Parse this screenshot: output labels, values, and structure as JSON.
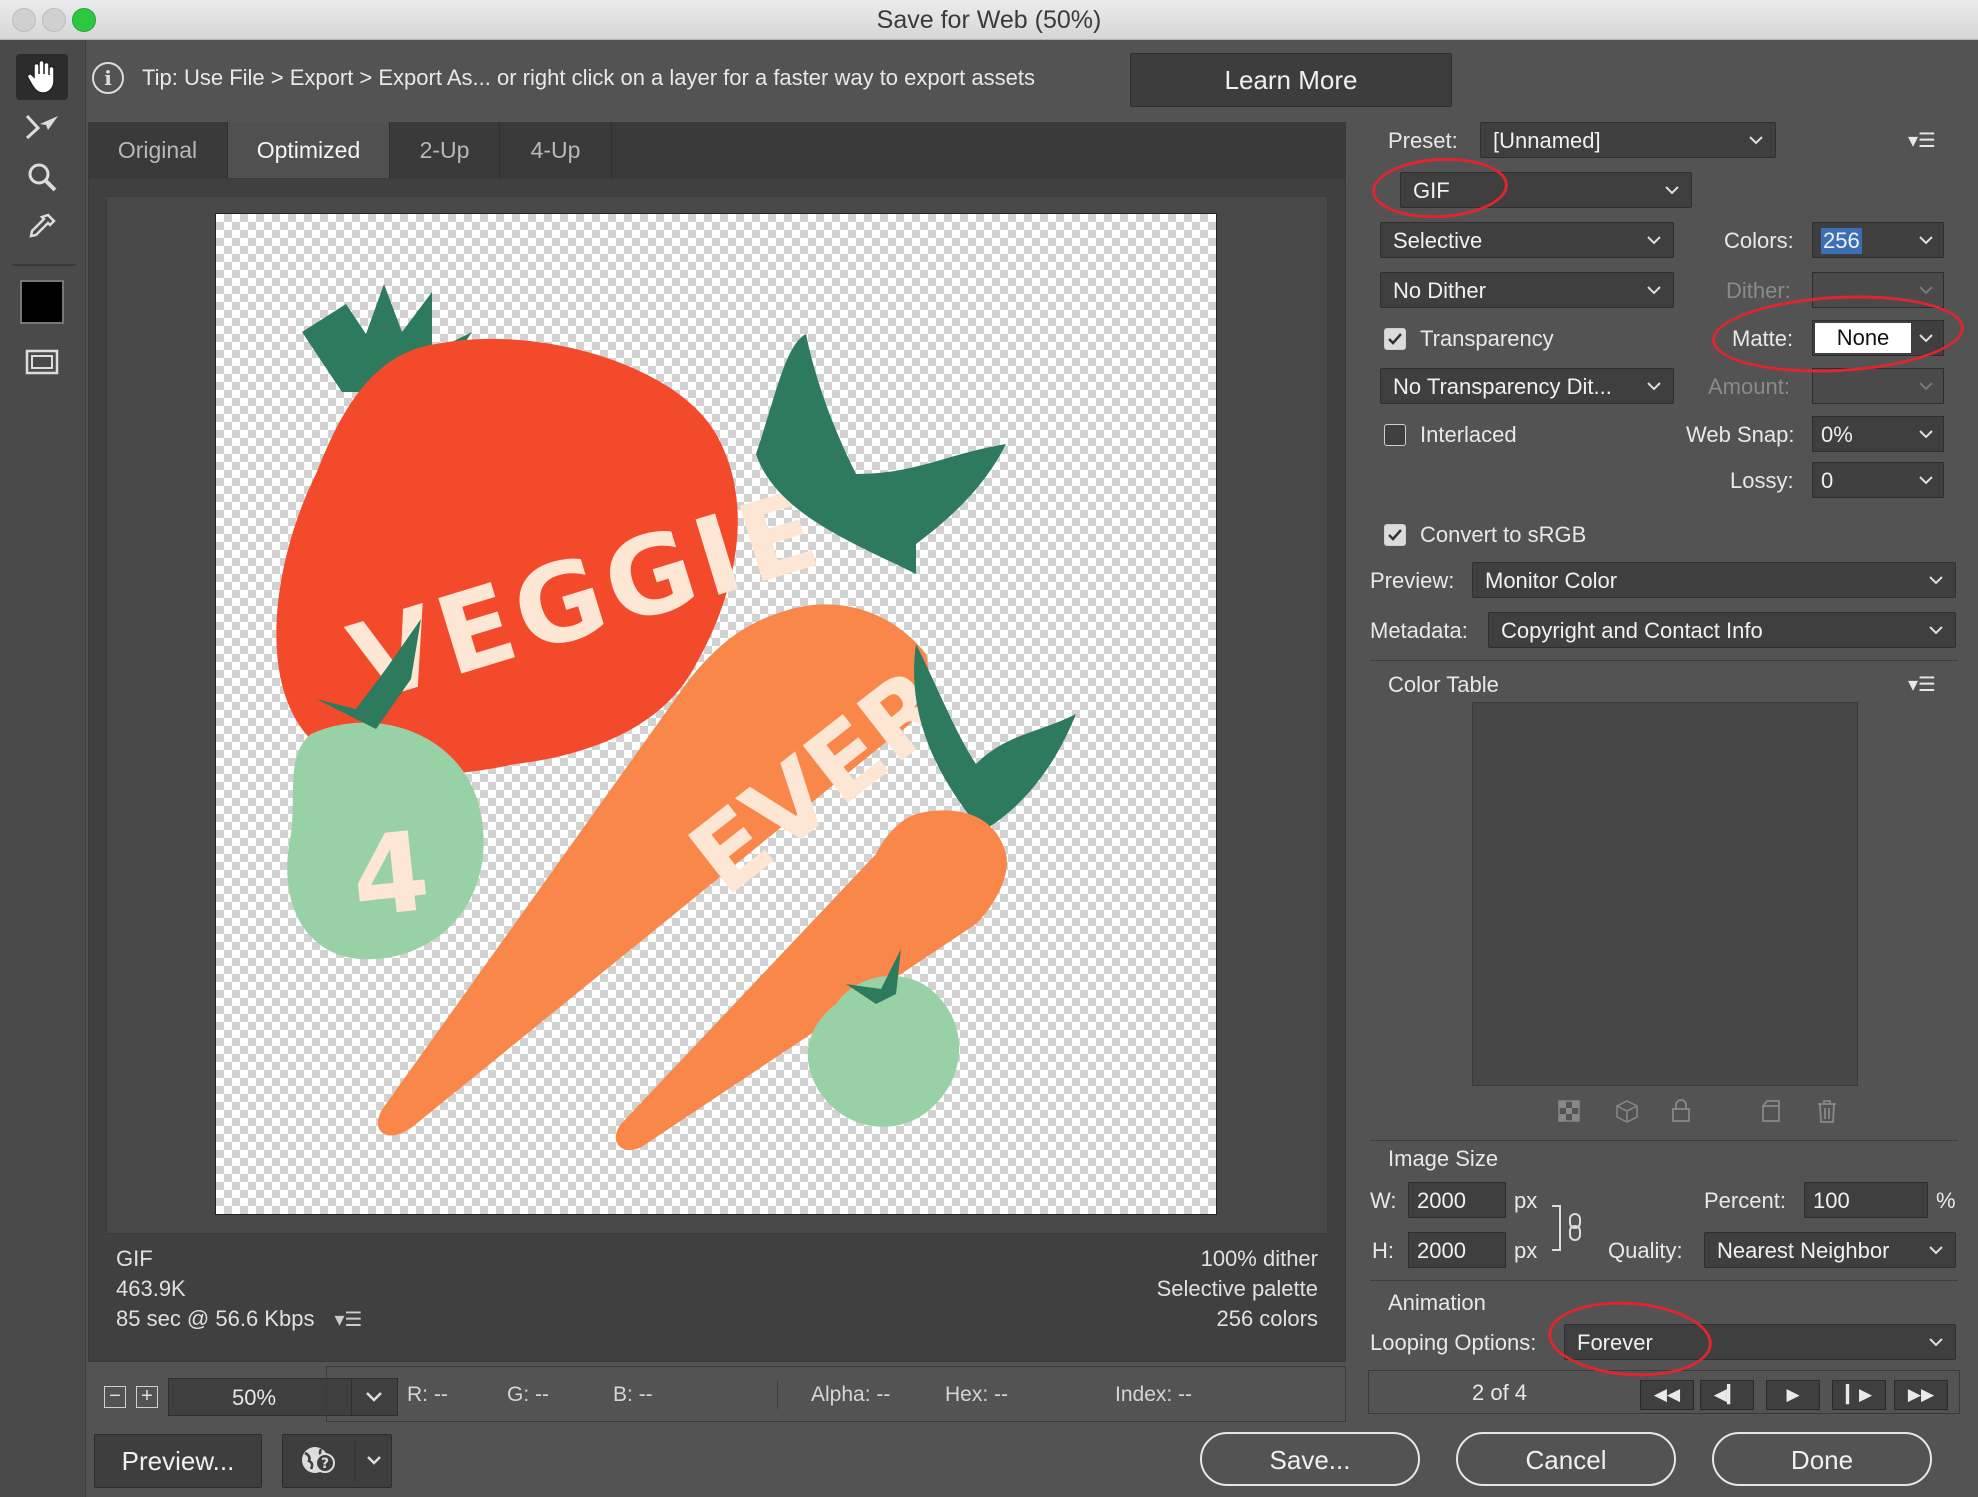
{
  "window": {
    "title": "Save for Web (50%)"
  },
  "tip": {
    "text": "Tip: Use File > Export > Export As...  or right click on a layer for a faster way to export assets",
    "learn_more": "Learn More"
  },
  "tabs": [
    {
      "label": "Original"
    },
    {
      "label": "Optimized"
    },
    {
      "label": "2-Up"
    },
    {
      "label": "4-Up"
    }
  ],
  "artwork": {
    "word1": "VEGGIE",
    "word2": "4",
    "word3": "EVER"
  },
  "info": {
    "format": "GIF",
    "size": "463.9K",
    "time": "85 sec @ 56.6 Kbps",
    "dither": "100% dither",
    "palette": "Selective palette",
    "colors": "256 colors"
  },
  "status": {
    "zoom": "50%",
    "r": "R: --",
    "g": "G: --",
    "b": "B: --",
    "alpha": "Alpha: --",
    "hex": "Hex: --",
    "index": "Index: --"
  },
  "buttons": {
    "preview": "Preview...",
    "save": "Save...",
    "cancel": "Cancel",
    "done": "Done"
  },
  "settings": {
    "preset_label": "Preset:",
    "preset_value": "[Unnamed]",
    "format": "GIF",
    "reduction": "Selective",
    "colors_label": "Colors:",
    "colors_value": "256",
    "dither_algo": "No Dither",
    "dither_label": "Dither:",
    "transparency_label": "Transparency",
    "transparency_checked": true,
    "matte_label": "Matte:",
    "matte_value": "None",
    "transparency_dither": "No Transparency Dit...",
    "amount_label": "Amount:",
    "interlaced_label": "Interlaced",
    "interlaced_checked": false,
    "websnap_label": "Web Snap:",
    "websnap_value": "0%",
    "lossy_label": "Lossy:",
    "lossy_value": "0",
    "srgb_label": "Convert to sRGB",
    "srgb_checked": true,
    "preview_label": "Preview:",
    "preview_value": "Monitor Color",
    "metadata_label": "Metadata:",
    "metadata_value": "Copyright and Contact Info"
  },
  "color_table": {
    "title": "Color Table"
  },
  "image_size": {
    "title": "Image Size",
    "w_label": "W:",
    "w_value": "2000",
    "h_label": "H:",
    "h_value": "2000",
    "unit": "px",
    "percent_label": "Percent:",
    "percent_value": "100",
    "percent_unit": "%",
    "quality_label": "Quality:",
    "quality_value": "Nearest Neighbor"
  },
  "animation": {
    "title": "Animation",
    "looping_label": "Looping Options:",
    "looping_value": "Forever",
    "frame_counter": "2 of 4"
  },
  "colors": {
    "accent_select": "#3d6fb6",
    "annotation": "#e0262c",
    "tomato": "#f44a2c",
    "carrot": "#fa874a",
    "leaf": "#2e7a5e",
    "mint": "#99d1a6",
    "cream": "#fde6d4"
  }
}
